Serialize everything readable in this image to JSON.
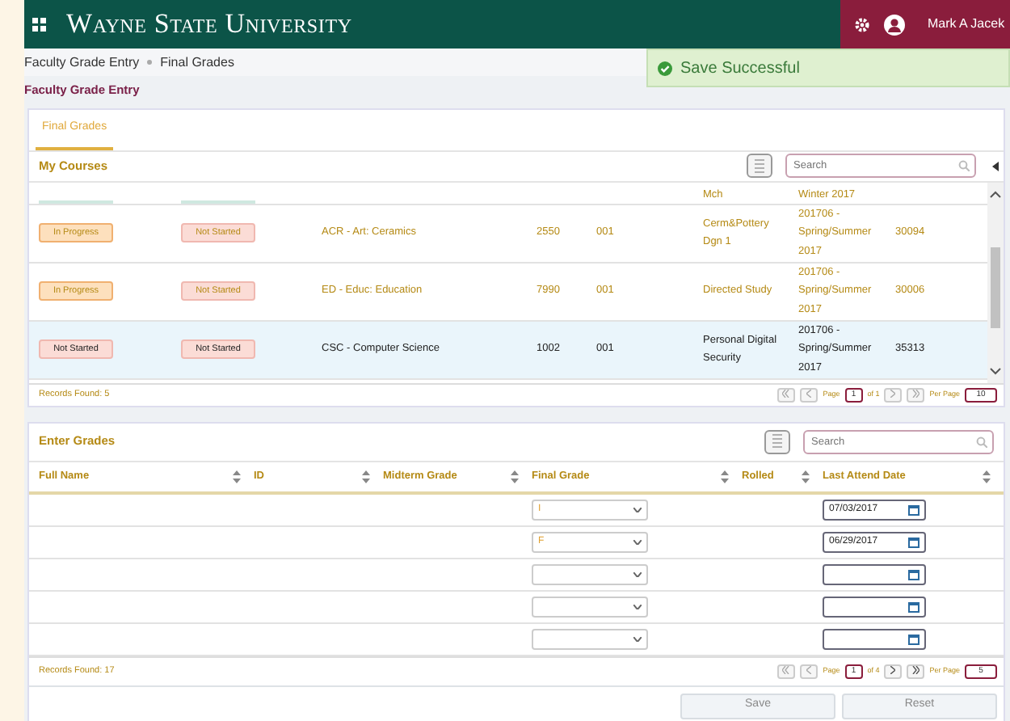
{
  "header": {
    "brand": "Wayne State University",
    "user": "Mark A Jacek"
  },
  "toast": {
    "message": "Save Successful"
  },
  "breadcrumb": [
    "Faculty Grade Entry",
    "Final Grades"
  ],
  "page_title": "Faculty Grade Entry",
  "tabs": [
    {
      "label": "Final Grades",
      "selected": true
    }
  ],
  "courses": {
    "title": "My Courses",
    "search_placeholder": "Search",
    "rows": [
      {
        "kind": "partial",
        "title": "Mch",
        "term": "Winter 2017",
        "selected": false
      },
      {
        "kind": "full",
        "midterm_status": "In Progress",
        "final_status": "Not Started",
        "subject": "ACR - Art: Ceramics",
        "course": "2550",
        "section": "001",
        "title": "Cerm&Pottery Dgn 1",
        "term": "201706 - Spring/Summer 2017",
        "crn": "30094",
        "selected": false
      },
      {
        "kind": "full",
        "midterm_status": "In Progress",
        "final_status": "Not Started",
        "subject": "ED - Educ: Education",
        "course": "7990",
        "section": "001",
        "title": "Directed Study",
        "term": "201706 - Spring/Summer 2017",
        "crn": "30006",
        "selected": false
      },
      {
        "kind": "full",
        "midterm_status": "Not Started",
        "final_status": "Not Started",
        "subject": "CSC - Computer Science",
        "course": "1002",
        "section": "001",
        "title": "Personal Digital Security",
        "term": "201706 - Spring/Summer 2017",
        "crn": "35313",
        "selected": true
      }
    ],
    "records": "Records Found: 5",
    "page_label": "Page",
    "page": "1",
    "of": "of 1",
    "per_page_label": "Per Page",
    "per_page": "10"
  },
  "grades": {
    "title": "Enter Grades",
    "search_placeholder": "Search",
    "columns": [
      "Full Name",
      "ID",
      "Midterm Grade",
      "Final Grade",
      "Rolled",
      "Last Attend Date"
    ],
    "rows": [
      {
        "final_grade": "I",
        "last_attend_date": "07/03/2017"
      },
      {
        "final_grade": "F",
        "last_attend_date": "06/29/2017"
      },
      {},
      {},
      {}
    ],
    "records": "Records Found: 17",
    "page_label": "Page",
    "page": "1",
    "of": "of 4",
    "per_page_label": "Per Page",
    "per_page": "5"
  },
  "buttons": [
    "Save",
    "Reset"
  ]
}
